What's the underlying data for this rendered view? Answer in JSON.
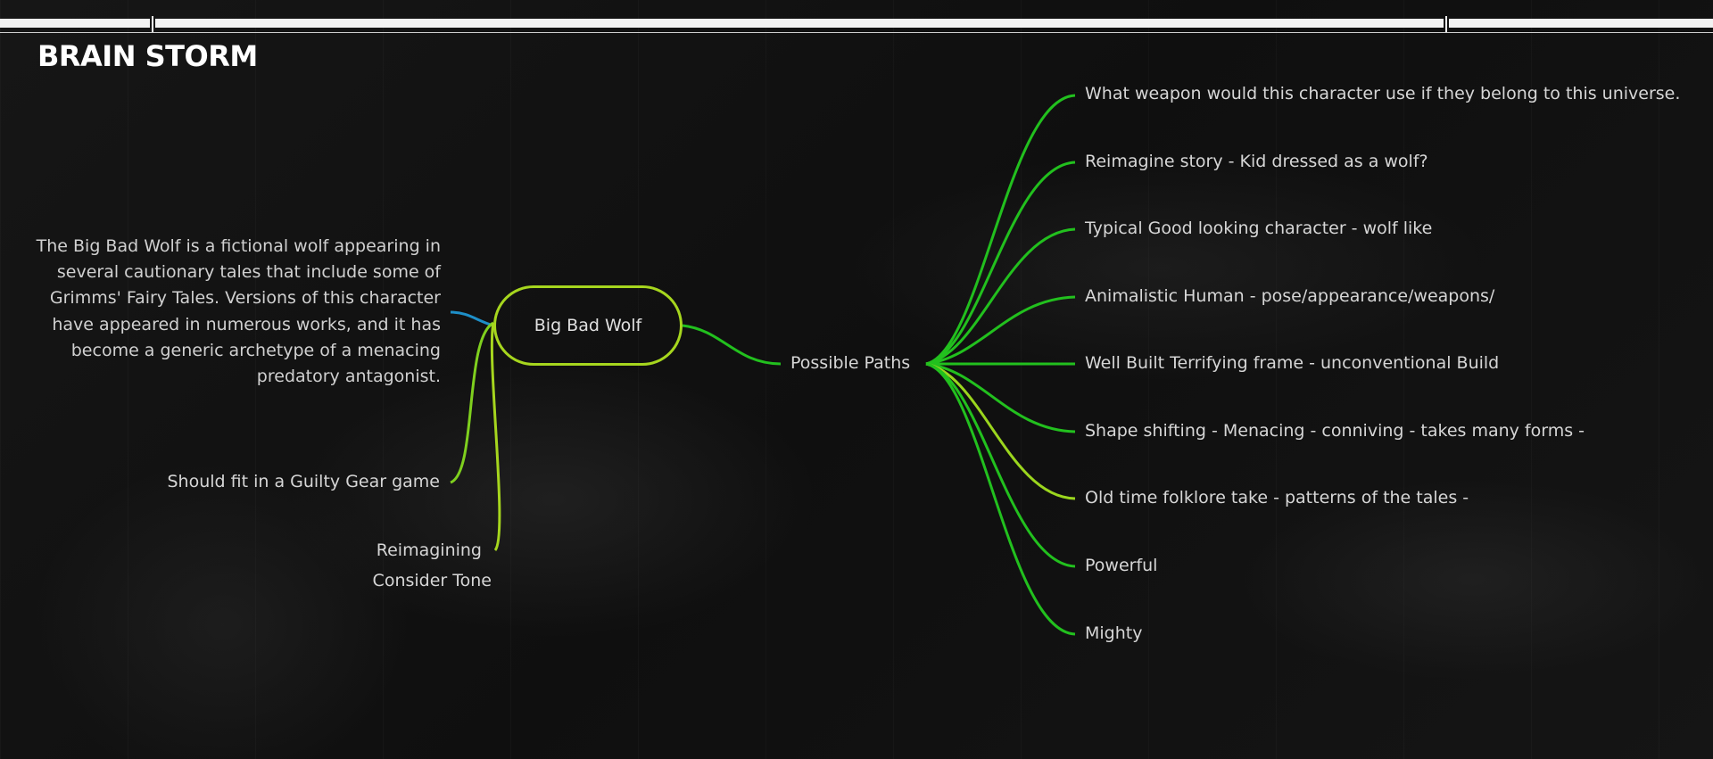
{
  "title": "BRAIN STORM",
  "central_node": "Big Bad Wolf",
  "description": "The Big Bad Wolf is a fictional wolf appearing in several cautionary tales that include some of Grimms' Fairy Tales. Versions of this character have appeared in numerous works, and it has become a generic archetype of a menacing predatory antagonist.",
  "left_nodes": {
    "guilty_gear": "Should fit in a Guilty Gear game",
    "reimagining": "Reimagining",
    "tone": "Consider Tone"
  },
  "hub": "Possible Paths",
  "paths": [
    "What weapon would this character use if they belong to this universe.",
    "Reimagine story - Kid dressed as a wolf?",
    "Typical Good looking character - wolf like",
    "Animalistic Human - pose/appearance/weapons/",
    "Well Built Terrifying frame - unconventional Build",
    "Shape shifting - Menacing - conniving - takes many forms -",
    "Old time folklore take - patterns of the tales -",
    "Powerful",
    "Mighty"
  ],
  "colors": {
    "green": "#22c01e",
    "lime": "#a6d61e",
    "blue": "#1e8fc8",
    "text": "#d6d6d6"
  }
}
